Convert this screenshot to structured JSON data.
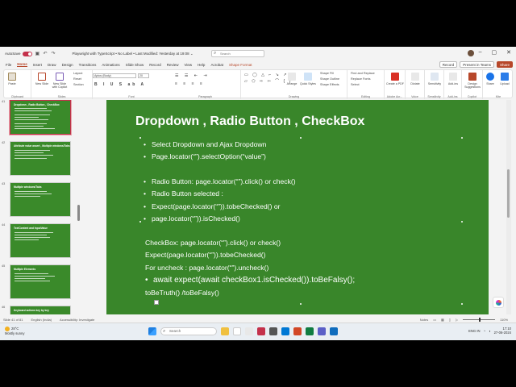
{
  "window": {
    "autosave_label": "AutoSave",
    "autosave_state": "Off",
    "doc_title": "Playwright with TypeScript  •  No Label  •  Last Modified: Yesterday at 19:08 ⌄",
    "search_placeholder": "Search"
  },
  "tabs": [
    "File",
    "Home",
    "Insert",
    "Draw",
    "Design",
    "Transitions",
    "Animations",
    "Slide Show",
    "Record",
    "Review",
    "View",
    "Help",
    "Acrobat",
    "Shape Format"
  ],
  "tab_actions": {
    "record": "Record",
    "present": "Present in Teams",
    "share": "Share"
  },
  "ribbon": {
    "groups": [
      "Clipboard",
      "Slides",
      "Font",
      "Paragraph",
      "Drawing",
      "Editing",
      "Adobe Acr...",
      "Voice",
      "Sensitivity",
      "Add-ins",
      "Copilot",
      "Kite"
    ],
    "paste": "Paste",
    "new_slide": "New Slide",
    "reuse": "New Slide with Copilot",
    "layout": "Layout",
    "reset": "Reset",
    "section": "Section",
    "font_name": "Aptos (Body)",
    "font_size": "20",
    "arrange": "Arrange",
    "quick_styles": "Quick Styles",
    "shape_fill": "Shape Fill",
    "shape_outline": "Shape Outline",
    "shape_effects": "Shape Effects",
    "find_replace": "Find and Replace",
    "replace_fonts": "Replace Fonts",
    "select": "Select",
    "create_pdf": "Create a PDF",
    "dictate": "Dictate",
    "sensitivity": "Sensitivity",
    "addins": "Add-ins",
    "design_suggestions": "Design Suggestions",
    "share": "Share",
    "upload": "Upload"
  },
  "thumbnails": [
    {
      "num": "41",
      "title": "Dropdown , Radio Button , CheckBox"
    },
    {
      "num": "42",
      "title": "Attribute value assert , Multiple windows/Tabs"
    },
    {
      "num": "43",
      "title": "Multiple windows/Tabs"
    },
    {
      "num": "44",
      "title": "TextContent and InputValue"
    },
    {
      "num": "45",
      "title": "Multiple Elements"
    },
    {
      "num": "46",
      "title": "Keyboard actions key by key"
    }
  ],
  "slide": {
    "title": "Dropdown ,  Radio Button , CheckBox",
    "bullets_a": [
      "Select Dropdown and Ajax Dropdown",
      "Page.locator(“”).selectOption(“value”)"
    ],
    "bullets_b": [
      "Radio Button: page.locator(“”).click() or check()",
      "Radio Button selected :",
      "Expect(page.locator(“”)).tobeChecked() or",
      "page.locator(“”)).isChecked()"
    ],
    "lines_c": [
      "CheckBox: page.locator(“”).click() or check()",
      "Expect(page.locator(“”)).tobeChecked()",
      "For uncheck : page.locator(“”).uncheck()"
    ],
    "await_line": "await expect(await checkBox1.isChecked()).toBeFalsy();",
    "last_line": "toBeTruth() /toBeFalsy()"
  },
  "status": {
    "slide_count": "Slide 41 of 81",
    "language": "English (India)",
    "accessibility": "Accessibility: Investigate",
    "notes": "Notes",
    "zoom": "110%"
  },
  "taskbar": {
    "temp": "28°C",
    "weather": "Mostly sunny",
    "search": "Search",
    "time": "17:10",
    "date": "27-06-2024",
    "lang": "ENG IN"
  }
}
